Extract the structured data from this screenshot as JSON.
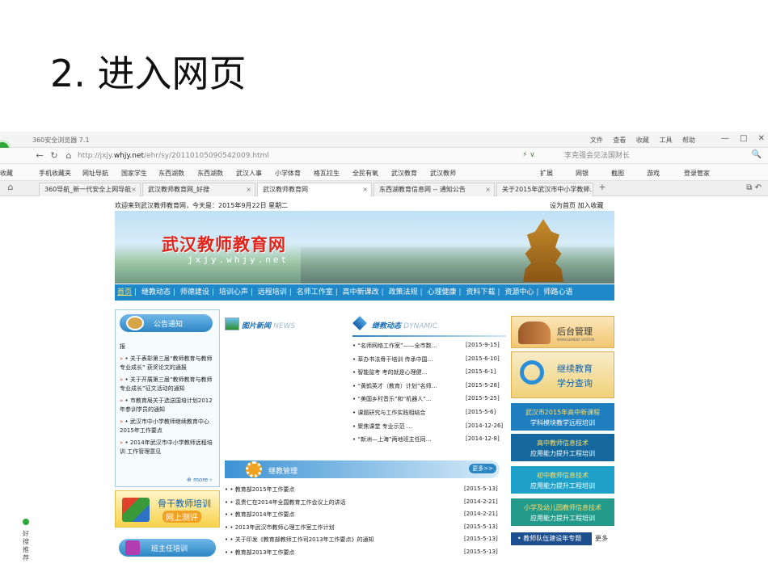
{
  "slide": {
    "title": "2. 进入网页"
  },
  "browser": {
    "app_title": "360安全浏览器 7.1",
    "menu": [
      "文件",
      "查看",
      "收藏",
      "工具",
      "帮助"
    ],
    "url_prefix": "http://jxjy.",
    "url_domain": "whjy.net",
    "url_path": "/ehr/sy/20110105090542009.html",
    "search_placeholder": "李克强会见法国财长",
    "bookmarks": [
      "收藏",
      "手机收藏夹",
      "网址导航",
      "国家学生",
      "东西湖数",
      "东西湖数",
      "武汉人事",
      "小学体育",
      "格瓦拉生",
      "全民有氧",
      "武汉教育",
      "武汉教师"
    ],
    "bookmarks_right": [
      "扩展",
      "网银",
      "截图",
      "游戏",
      "登录管家"
    ],
    "tabs": [
      {
        "label": "360导航_新一代安全上网导航",
        "active": false
      },
      {
        "label": "武汉教师教育网_好搜",
        "active": false
      },
      {
        "label": "武汉教师教育网",
        "active": true
      },
      {
        "label": "东西湖教育信息网 -- 通知公告",
        "active": false
      },
      {
        "label": "关于2015年武汉市中小学教师…",
        "active": false
      }
    ],
    "new_tab": "+",
    "close_glyph": "×"
  },
  "page": {
    "welcome": "欢迎来到武汉教师教育网，今天是：2015年9月22日 星期二",
    "top_links": "设为首页  加入收藏",
    "banner_title": "武汉教师教育网",
    "banner_url": "jxjy.whjy.net",
    "nav": [
      "首页",
      "继教动态",
      "师德建设",
      "培训心声",
      "远程培训",
      "名师工作室",
      "高中新课改",
      "政策法规",
      "心理健康",
      "资料下载",
      "资源中心",
      "师路心语"
    ],
    "notice": {
      "heading": "公告通知",
      "first": "报",
      "items": [
        "• 关于表彰第三届“教师教育与教师专业成长” 获奖论文的通报",
        "• 关于开展第三届“教师教育与教师专业成长”征文活动的通知",
        "• 市教育局关于选送国培计划2012年参训学员的通知",
        "• 武汉市中小学教师继续教育中心 2015年工作要点",
        "• 2014年武汉市中小学教师远程培训 工作管理意见"
      ],
      "more": "more"
    },
    "train": {
      "t1": "骨干教师培训",
      "t2": "网上测评"
    },
    "class": "班主任培训",
    "news_heading": "图片新闻",
    "news_en": "NEWS",
    "dynamic_heading": "继教动态",
    "dynamic_en": "DYNAMIC",
    "dynamic": [
      {
        "t": "• “名师网络工作室”——全市数…",
        "d": "[2015-9-15]"
      },
      {
        "t": "• 莘办书法骨干培训 传承中国…",
        "d": "[2015-6-10]"
      },
      {
        "t": "• 智能监考 考的就是心理健…",
        "d": "[2015-6-1]"
      },
      {
        "t": "• “黄鹤英才（教育）计划”名师…",
        "d": "[2015-5-28]"
      },
      {
        "t": "• “美国乡村音乐”和“机器人”…",
        "d": "[2015-5-25]"
      },
      {
        "t": "• 课题研究与工作实践相结合",
        "d": "[2015-5-6]"
      },
      {
        "t": "• 聚焦课堂 专业示范 …",
        "d": "[2014-12-26]"
      },
      {
        "t": "• “新洲—上海”两地班主任同…",
        "d": "[2014-12-8]"
      }
    ],
    "mgmt_heading": "继教管理",
    "mgmt_more": "更多>>",
    "mgmt": [
      {
        "t": "• • 教育部2015年工作要点",
        "d": "[2015-5-13]"
      },
      {
        "t": "• • 袁贵仁在2014年全国教育工作会议上的讲话",
        "d": "[2014-2-21]"
      },
      {
        "t": "• • 教育部2014年工作要点",
        "d": "[2014-2-21]"
      },
      {
        "t": "• • 2013年武汉市教师心理工作室工作计划",
        "d": "[2015-5-13]"
      },
      {
        "t": "• • 关于印发《教育部教师工作司2013年工作要点》的通知",
        "d": "[2015-5-13]"
      },
      {
        "t": "• • 教育部2013年工作要点",
        "d": "[2015-5-13]"
      }
    ],
    "right": {
      "admin": "后台管理",
      "admin_sub": "MANAGEMENT SYSTEM",
      "query1": "继续教育",
      "query2": "学分查询",
      "a1": "武汉市2015年高中新课程",
      "a2": "学科模块教学远程培训",
      "b1": "高中教师信息技术",
      "b2": "应用能力提升工程培训",
      "c1": "初中教师信息技术",
      "c2": "应用能力提升工程培训",
      "d1": "小学及幼儿园教师信息技术",
      "d2": "应用能力提升工程培训",
      "team": "• 教师队伍建设年专题",
      "team_more": "更多"
    },
    "side_float": "好搜推荐"
  },
  "colors": {
    "nav_blue": "#1e88c8",
    "banner_red": "#e0241b",
    "accent_orange": "#f1a222"
  }
}
